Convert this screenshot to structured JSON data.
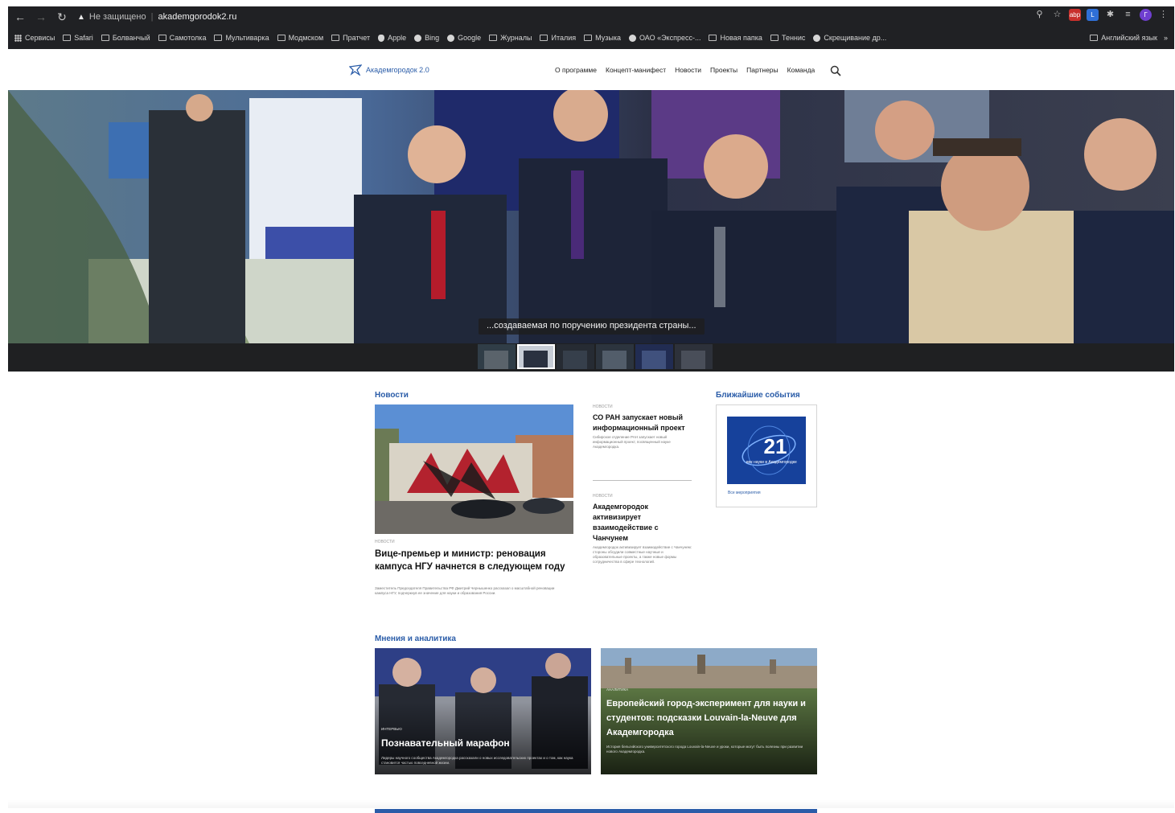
{
  "browser": {
    "security_label": "Не защищено",
    "url": "akademgorodok2.ru",
    "bookmarks": [
      {
        "label": "Сервисы",
        "icon": "apps-icon"
      },
      {
        "label": "Safari",
        "icon": "folder-icon"
      },
      {
        "label": "Болванчый",
        "icon": "folder-icon"
      },
      {
        "label": "Самотолка",
        "icon": "folder-icon"
      },
      {
        "label": "Мультиварка",
        "icon": "folder-icon"
      },
      {
        "label": "Модмском",
        "icon": "folder-icon"
      },
      {
        "label": "Пратчет",
        "icon": "folder-icon"
      },
      {
        "label": "Apple",
        "icon": "apple-icon"
      },
      {
        "label": "Bing",
        "icon": "globe-icon"
      },
      {
        "label": "Google",
        "icon": "globe-icon"
      },
      {
        "label": "Журналы",
        "icon": "folder-icon"
      },
      {
        "label": "Италия",
        "icon": "folder-icon"
      },
      {
        "label": "Музыка",
        "icon": "folder-icon"
      },
      {
        "label": "ОАО «Экспресс-...",
        "icon": "globe-icon"
      },
      {
        "label": "Новая папка",
        "icon": "folder-icon"
      },
      {
        "label": "Теннис",
        "icon": "folder-icon"
      },
      {
        "label": "Скрещивание др...",
        "icon": "globe-icon"
      }
    ],
    "bookmark_last": "Английский язык"
  },
  "site": {
    "logo_text": "Академгородок 2.0",
    "nav": [
      "О программе",
      "Концепт-манифест",
      "Новости",
      "Проекты",
      "Партнеры",
      "Команда"
    ]
  },
  "hero": {
    "caption": "...создаваемая по поручению президента страны...",
    "active_slide": 1,
    "slides_count": 6
  },
  "news": {
    "section_title": "Новости",
    "lead": {
      "tag": "новости",
      "title": "Вице-премьер и министр: реновация кампуса НГУ начнется в следующем году",
      "description": "Заместитель Председателя Правительства РФ Дмитрий Чернышенко рассказал о масштабной реновации кампуса НГУ, подчеркнув ее значение для науки и образования России."
    },
    "side": [
      {
        "tag": "новости",
        "title": "СО РАН запускает новый информационный проект",
        "description": "Сибирское отделение РАН запускает новый информационный проект, посвященный науке Академгородка."
      },
      {
        "tag": "новости",
        "title": "Академгородок активизирует взаимодействие с Чанчунем",
        "description": "Академгородок активизирует взаимодействие с Чанчунем: стороны обсудили совместные научные и образовательные проекты, а также новые формы сотрудничества в сфере технологий."
      }
    ]
  },
  "events": {
    "section_title": "Ближайшие события",
    "badge_number": "21",
    "badge_caption": "век науки в Академгородке",
    "link_label": "Все мероприятия"
  },
  "opinions": {
    "section_title": "Мнения и аналитика",
    "cards": [
      {
        "tag": "интервью",
        "title": "Познавательный марафон",
        "description": "Лидеры научного сообщества Академгородка рассказали о новых исследовательских проектах и о том, как наука становится частью повседневной жизни."
      },
      {
        "tag": "аналитика",
        "title": "Европейский город-эксперимент для науки и студентов: подсказки Louvain-la-Neuve для Академгородка",
        "description": "История бельгийского университетского города Louvain-la-Neuve и уроки, которые могут быть полезны при развитии нового Академгородка."
      }
    ]
  },
  "colors": {
    "brand_blue": "#2a5ca8",
    "chrome_dark": "#202124",
    "hero_bg": "#1f2022"
  }
}
